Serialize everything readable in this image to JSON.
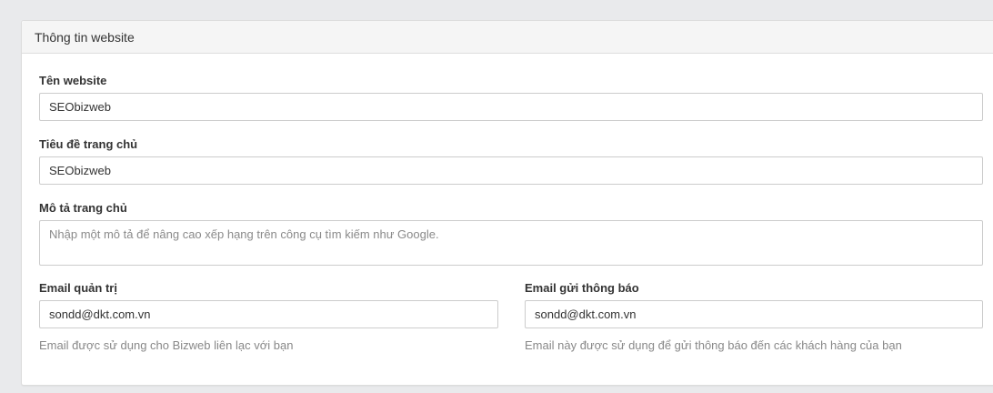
{
  "panel": {
    "title": "Thông tin website"
  },
  "fields": {
    "site_name": {
      "label": "Tên website",
      "value": "SEObizweb"
    },
    "home_title": {
      "label": "Tiêu đề trang chủ",
      "value": "SEObizweb"
    },
    "home_description": {
      "label": "Mô tả trang chủ",
      "value": "",
      "placeholder": "Nhập một mô tả để nâng cao xếp hạng trên công cụ tìm kiếm như Google."
    },
    "admin_email": {
      "label": "Email quản trị",
      "value": "sondd@dkt.com.vn",
      "help": "Email được sử dụng cho Bizweb liên lạc với bạn"
    },
    "notify_email": {
      "label": "Email gửi thông báo",
      "value": "sondd@dkt.com.vn",
      "help": "Email này được sử dụng để gửi thông báo đến các khách hàng của bạn"
    }
  }
}
